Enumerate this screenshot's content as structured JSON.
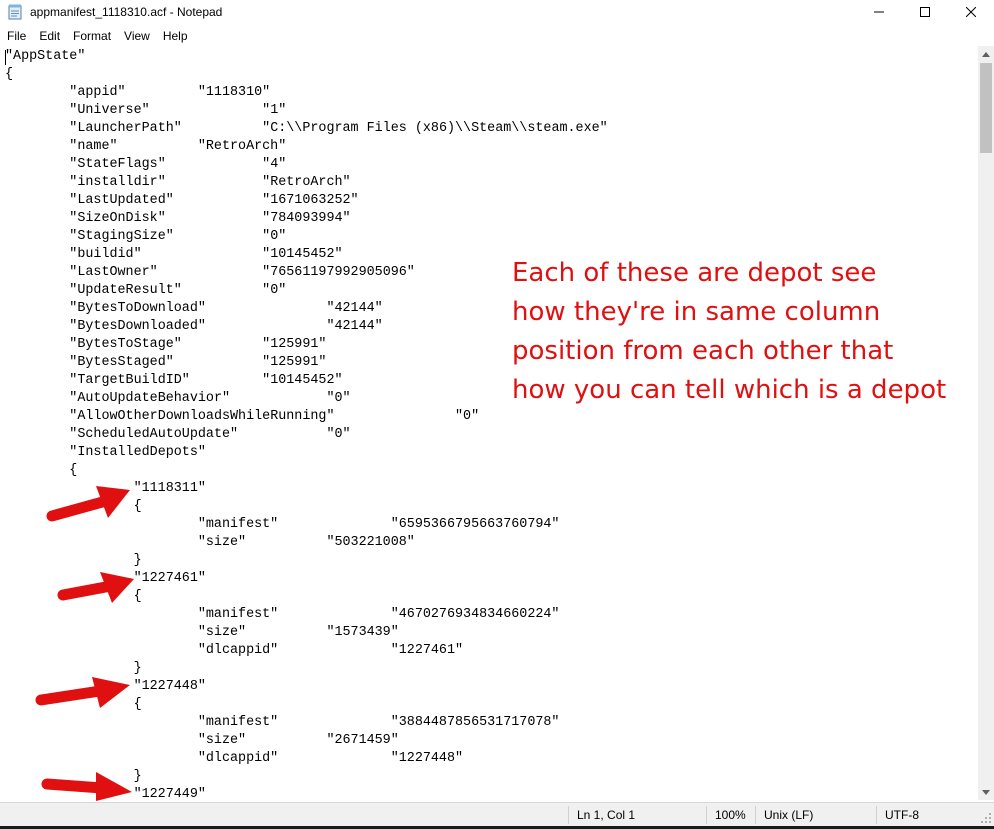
{
  "window": {
    "title": "appmanifest_1118310.acf - Notepad",
    "controls": [
      "minimize",
      "maximize",
      "close"
    ]
  },
  "menu": [
    "File",
    "Edit",
    "Format",
    "View",
    "Help"
  ],
  "editor": {
    "lines": [
      "\"AppState\"",
      "{",
      "\t\"appid\"\t\t\"1118310\"",
      "\t\"Universe\"\t\t\"1\"",
      "\t\"LauncherPath\"\t\t\"C:\\\\Program Files (x86)\\\\Steam\\\\steam.exe\"",
      "\t\"name\"\t\t\"RetroArch\"",
      "\t\"StateFlags\"\t\t\"4\"",
      "\t\"installdir\"\t\t\"RetroArch\"",
      "\t\"LastUpdated\"\t\t\"1671063252\"",
      "\t\"SizeOnDisk\"\t\t\"784093994\"",
      "\t\"StagingSize\"\t\t\"0\"",
      "\t\"buildid\"\t\t\"10145452\"",
      "\t\"LastOwner\"\t\t\"76561197992905096\"",
      "\t\"UpdateResult\"\t\t\"0\"",
      "\t\"BytesToDownload\"\t\t\"42144\"",
      "\t\"BytesDownloaded\"\t\t\"42144\"",
      "\t\"BytesToStage\"\t\t\"125991\"",
      "\t\"BytesStaged\"\t\t\"125991\"",
      "\t\"TargetBuildID\"\t\t\"10145452\"",
      "\t\"AutoUpdateBehavior\"\t\t\"0\"",
      "\t\"AllowOtherDownloadsWhileRunning\"\t\t\"0\"",
      "\t\"ScheduledAutoUpdate\"\t\t\"0\"",
      "\t\"InstalledDepots\"",
      "\t{",
      "\t\t\"1118311\"",
      "\t\t{",
      "\t\t\t\"manifest\"\t\t\"6595366795663760794\"",
      "\t\t\t\"size\"\t\t\"503221008\"",
      "\t\t}",
      "\t\t\"1227461\"",
      "\t\t{",
      "\t\t\t\"manifest\"\t\t\"4670276934834660224\"",
      "\t\t\t\"size\"\t\t\"1573439\"",
      "\t\t\t\"dlcappid\"\t\t\"1227461\"",
      "\t\t}",
      "\t\t\"1227448\"",
      "\t\t{",
      "\t\t\t\"manifest\"\t\t\"3884487856531717078\"",
      "\t\t\t\"size\"\t\t\"2671459\"",
      "\t\t\t\"dlcappid\"\t\t\"1227448\"",
      "\t\t}",
      "\t\t\"1227449\""
    ]
  },
  "statusbar": {
    "position": "Ln 1, Col 1",
    "zoom": "100%",
    "line_ending": "Unix (LF)",
    "encoding": "UTF-8"
  },
  "annotation": {
    "color": "#e01010",
    "lines": [
      "Each of these are depot see",
      "how they're in same column",
      "position from each other that",
      "how you can tell which is a depot"
    ]
  }
}
